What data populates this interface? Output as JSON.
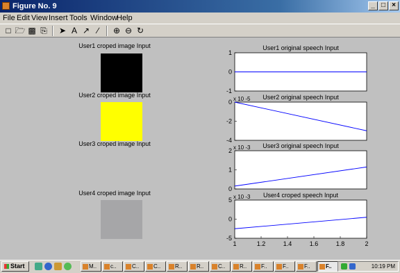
{
  "window": {
    "title": "Figure No. 9"
  },
  "menu": [
    "File",
    "Edit",
    "View",
    "Insert",
    "Tools",
    "Window",
    "Help"
  ],
  "toolbar_icons": [
    "new-figure-icon",
    "open-file-icon",
    "save-icon",
    "print-icon",
    "select-arrow-icon",
    "insert-text-icon",
    "insert-arrow-icon",
    "insert-line-icon",
    "zoom-in-icon",
    "zoom-out-icon",
    "rotate-3d-icon"
  ],
  "images": [
    {
      "title": "User1 croped image Input",
      "color": "#000000"
    },
    {
      "title": "User2 croped image Input",
      "color": "#ffff00"
    },
    {
      "title": "User3 croped image Input",
      "color": "#c0c0c0"
    },
    {
      "title": "User4 croped image Input",
      "color": "#a6a6a8"
    }
  ],
  "chart_data": [
    {
      "type": "line",
      "title": "User1 original speech Input",
      "ylim": [
        -1,
        1
      ],
      "yticks": [
        "1",
        "0",
        "-1"
      ],
      "xlim": [
        1,
        2
      ],
      "series": [
        {
          "x": [
            1,
            2
          ],
          "values": [
            0,
            0
          ]
        }
      ]
    },
    {
      "type": "line",
      "title": "User2 original speech Input",
      "ylim": [
        -4,
        0
      ],
      "yticks": [
        "0",
        "-2",
        "-4"
      ],
      "yexponent": "x 10^-5",
      "xlim": [
        1,
        2
      ],
      "series": [
        {
          "x": [
            1,
            2
          ],
          "values": [
            0,
            -3
          ]
        }
      ]
    },
    {
      "type": "line",
      "title": "User3 original speech Input",
      "ylim": [
        0,
        2
      ],
      "yticks": [
        "2",
        "1",
        "0"
      ],
      "yexponent": "x 10^-3",
      "xlim": [
        1,
        2
      ],
      "series": [
        {
          "x": [
            1,
            2
          ],
          "values": [
            0.15,
            1.15
          ]
        }
      ]
    },
    {
      "type": "line",
      "title": "User4 croped speech Input",
      "ylim": [
        -5,
        5
      ],
      "yticks": [
        "5",
        "0",
        "-5"
      ],
      "yexponent": "x 10^-3",
      "xlim": [
        1,
        2
      ],
      "xticks": [
        "1",
        "1.2",
        "1.4",
        "1.6",
        "1.8",
        "2"
      ],
      "series": [
        {
          "x": [
            1,
            2
          ],
          "values": [
            -2.5,
            0.5
          ]
        }
      ]
    }
  ],
  "taskbar": {
    "start": "Start",
    "tasks": [
      "M..",
      "c..",
      "C..",
      "C..",
      "R..",
      "R..",
      "C..",
      "R..",
      "F..",
      "F..",
      "F..",
      "F.."
    ],
    "clock": "10:19 PM"
  }
}
